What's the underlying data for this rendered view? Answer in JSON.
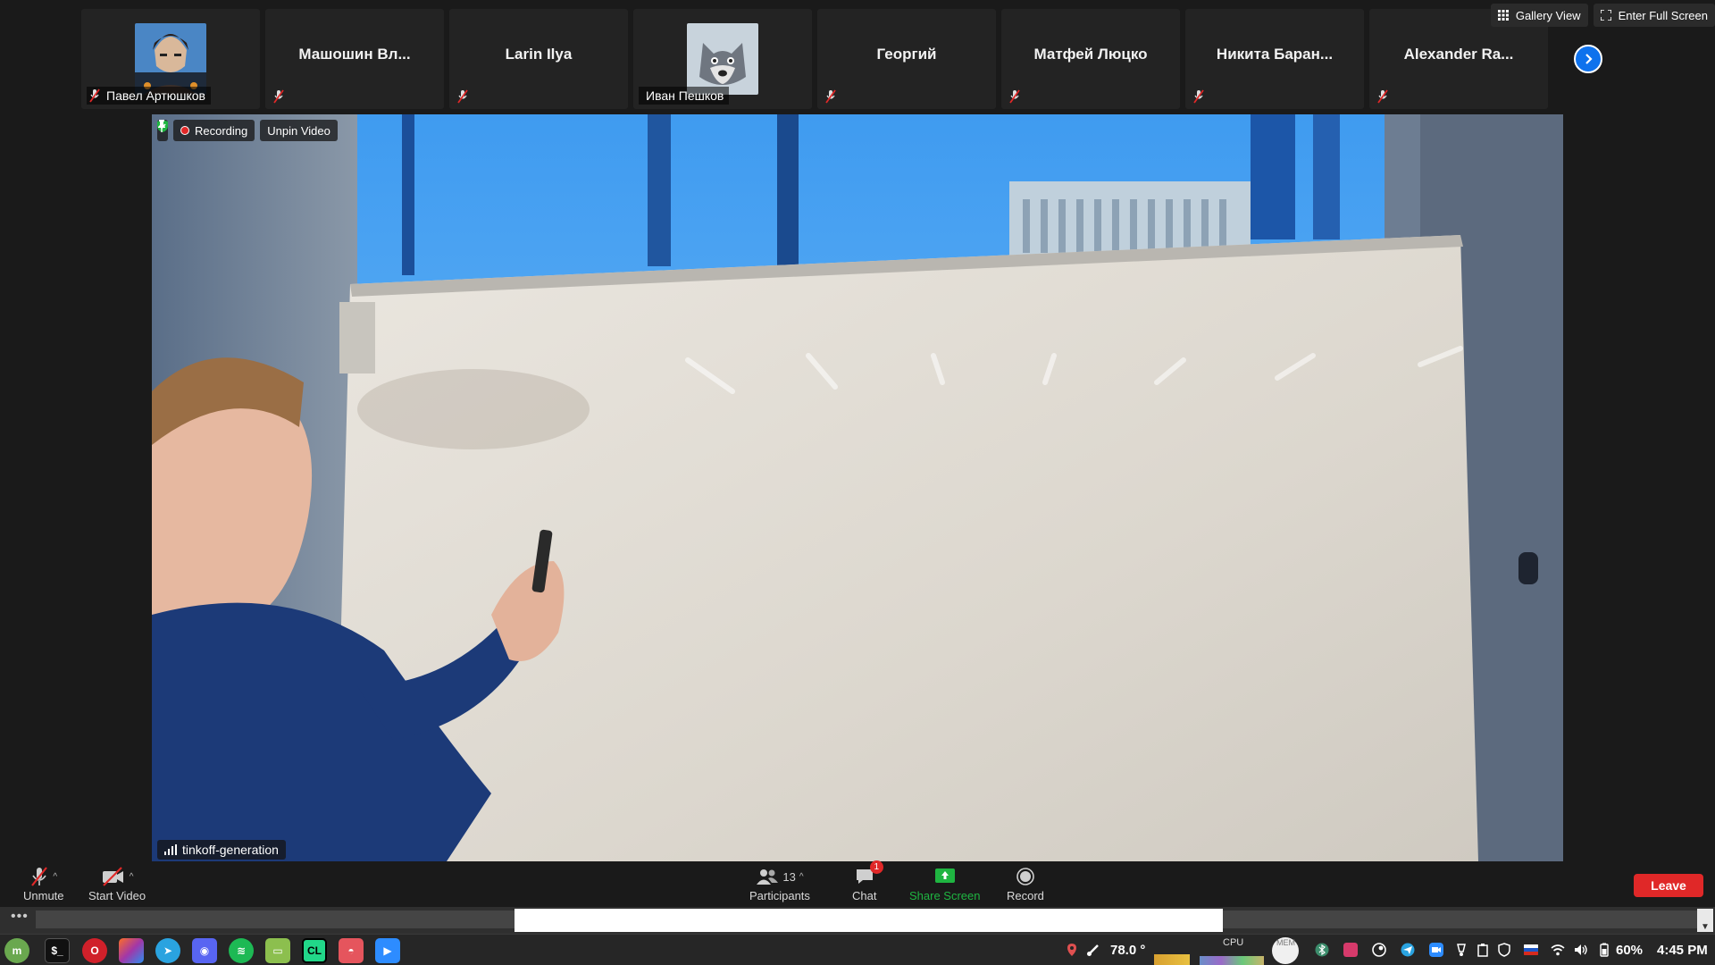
{
  "top_actions": {
    "gallery_view": "Gallery View",
    "enter_full_screen": "Enter Full Screen"
  },
  "participants": [
    {
      "name": "Павел Артюшков",
      "has_video": true,
      "avatar": "anime-man"
    },
    {
      "name": "Машошин Вл...",
      "has_video": false
    },
    {
      "name": "Larin Ilya",
      "has_video": false
    },
    {
      "name": "Иван Пешков",
      "has_video": true,
      "avatar": "cartoon-wolf"
    },
    {
      "name": "Георгий",
      "has_video": false
    },
    {
      "name": "Матфей Люцко",
      "has_video": false
    },
    {
      "name": "Никита Баран...",
      "has_video": false
    },
    {
      "name": "Alexander Ra...",
      "has_video": false
    }
  ],
  "main_video": {
    "recording_label": "Recording",
    "unpin_label": "Unpin Video",
    "speaker_name": "tinkoff-generation"
  },
  "toolbar": {
    "unmute": "Unmute",
    "start_video": "Start Video",
    "participants_label": "Participants",
    "participants_count": "13",
    "chat": "Chat",
    "chat_badge": "1",
    "share_screen": "Share Screen",
    "record": "Record",
    "leave": "Leave"
  },
  "tray": {
    "temperature": "78.0 °",
    "cpu_label": "CPU",
    "mem_label": "MEM",
    "battery": "60%",
    "clock": "4:45 PM"
  },
  "colors": {
    "zoom_blue": "#0e72ed",
    "leave_red": "#e02828",
    "share_green": "#1fb541",
    "panel_bg": "#1a1a1a",
    "tile_bg": "#232323"
  }
}
